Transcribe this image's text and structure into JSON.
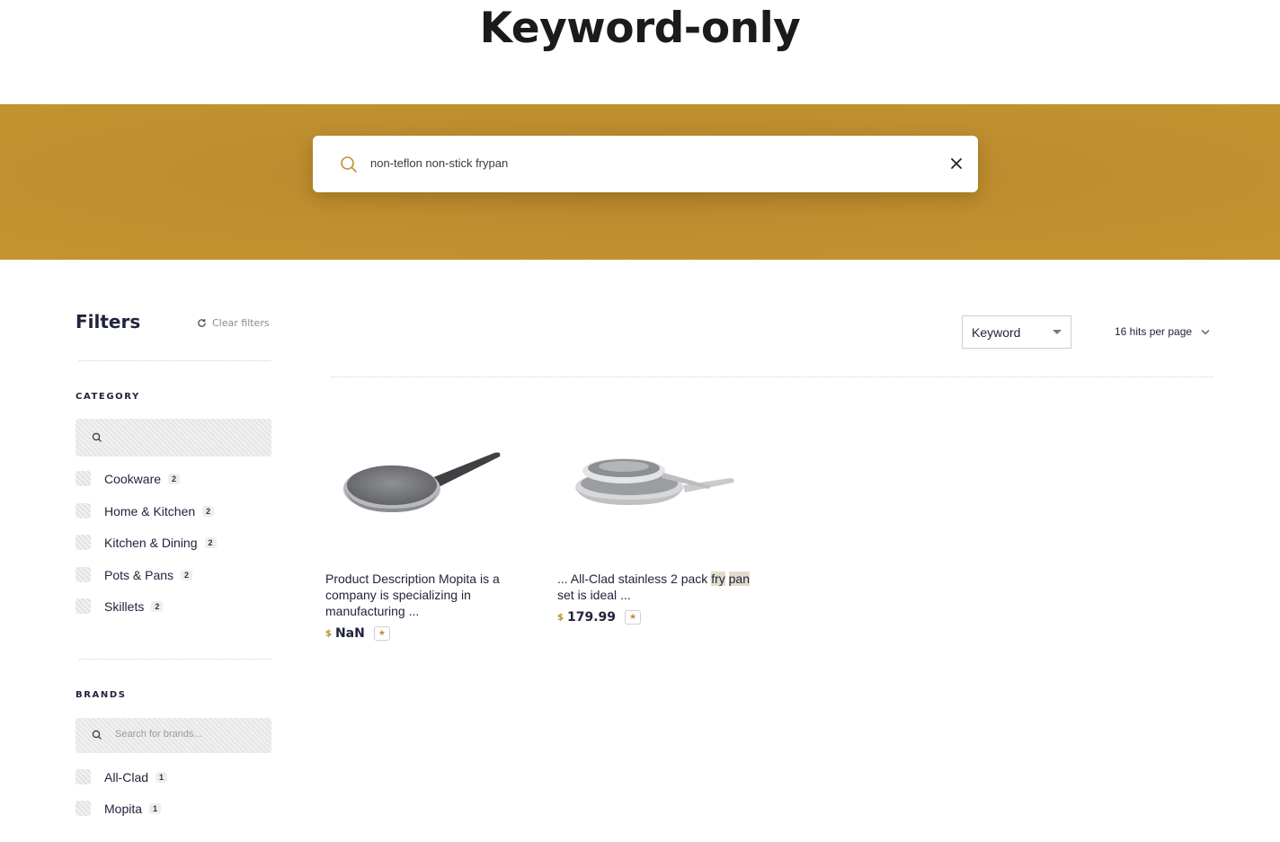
{
  "page": {
    "title": "Keyword-only"
  },
  "search": {
    "query": "non-teflon non-stick frypan",
    "clear_icon": "close-icon",
    "search_icon": "search-icon"
  },
  "filters": {
    "title": "Filters",
    "clear_label": "Clear filters",
    "category": {
      "label": "CATEGORY",
      "placeholder": "",
      "items": [
        {
          "label": "Cookware",
          "count": "2"
        },
        {
          "label": "Home & Kitchen",
          "count": "2"
        },
        {
          "label": "Kitchen & Dining",
          "count": "2"
        },
        {
          "label": "Pots & Pans",
          "count": "2"
        },
        {
          "label": "Skillets",
          "count": "2"
        }
      ]
    },
    "brands": {
      "label": "BRANDS",
      "placeholder": "Search for brands...",
      "items": [
        {
          "label": "All-Clad",
          "count": "1"
        },
        {
          "label": "Mopita",
          "count": "1"
        }
      ]
    }
  },
  "toolbar": {
    "sort_value": "Keyword",
    "hits_per_page": "16 hits per page"
  },
  "hits": [
    {
      "description": "Product Description Mopita is a company is specializing in manufacturing ...",
      "currency": "$",
      "price": "NaN",
      "rating_icon": "star-icon"
    },
    {
      "description_before": "... All-Clad stainless 2 pack ",
      "highlight_1": "fry",
      "highlight_2": "pan",
      "description_after": " set is ideal ...",
      "currency": "$",
      "price": "179.99",
      "rating_icon": "star-icon"
    }
  ],
  "colors": {
    "accent": "#c0902f",
    "text": "#21243d",
    "highlight": "#e3dccb"
  }
}
